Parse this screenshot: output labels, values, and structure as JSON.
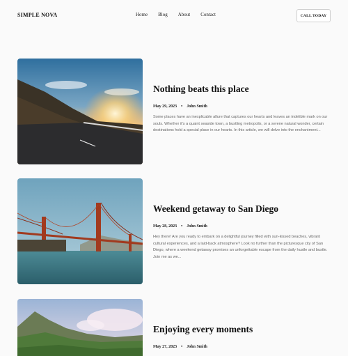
{
  "header": {
    "brand": "SIMPLE NOVA",
    "nav": [
      "Home",
      "Blog",
      "About",
      "Contact"
    ],
    "cta": "CALL TODAY"
  },
  "posts": [
    {
      "title": "Nothing beats this place",
      "date": "May 29, 2023",
      "author": "John Smith",
      "excerpt": "Some places have an inexplicable allure that captures our hearts and leaves an indelible mark on our souls. Whether it's a quaint seaside town, a bustling metropolis, or a serene natural wonder, certain destinations hold a special place in our hearts. In this article, we will delve into the enchantment...",
      "image": "coastal-road-sunset"
    },
    {
      "title": "Weekend getaway to San Diego",
      "date": "May 28, 2023",
      "author": "John Smith",
      "excerpt": "Hey there! Are you ready to embark on a delightful journey filled with sun-kissed beaches, vibrant cultural experiences, and a laid-back atmosphere? Look no further than the picturesque city of San Diego, where a weekend getaway promises an unforgettable escape from the daily hustle and bustle. Join me as we...",
      "image": "suspension-bridge"
    },
    {
      "title": "Enjoying every moments",
      "date": "May 27, 2023",
      "author": "John Smith",
      "excerpt": "",
      "image": "green-mountains"
    }
  ],
  "colors": {
    "background": "#fafafa",
    "text": "#111111",
    "muted": "#666666"
  }
}
